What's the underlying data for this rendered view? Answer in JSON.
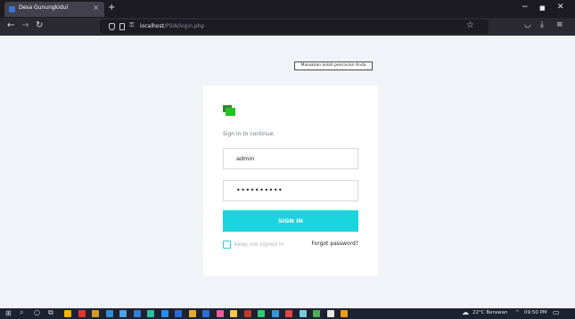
{
  "browser": {
    "tab_title": "Desa Gunungkidul",
    "tab_close": "×",
    "new_tab": "+",
    "window_controls": [
      "−",
      "■",
      "✕"
    ],
    "url_host": "localhost",
    "url_path": "/PSIA/login.php",
    "nav_icons": [
      "back-icon",
      "forward-icon",
      "reload-icon"
    ]
  },
  "tooltip": "Masukkan kolah pencarian Anda",
  "login": {
    "prompt": "Sign in to continue.",
    "username_value": "admin",
    "password_value": "••••••••••",
    "submit_label": "SIGN IN",
    "remember_label": "Keep me signed in",
    "forgot_label": "Forgot password?"
  },
  "taskbar": {
    "weather": "22°C  Berawan",
    "chevron": "^",
    "time": "09:50 PM",
    "app_colors": [
      "#d8d8de",
      "#d8d8de",
      "#d8d8de",
      "#f0b400",
      "#e2362b",
      "#d69a2b",
      "#2c8fd6",
      "#4ba3e3",
      "#3a7bd5",
      "#2ac3a2",
      "#1f8ff0",
      "#2a6ad9",
      "#e8a92b",
      "#2c6fd9",
      "#e85d9b",
      "#f2c94c",
      "#c0392b",
      "#2ecc71",
      "#3498db",
      "#e84343",
      "#7ec8e3",
      "#4caf50",
      "#e8e8e8",
      "#f39c12"
    ]
  },
  "colors": {
    "accent": "#1bd4dd",
    "logo_green": "#22c322",
    "page_bg": "#f2f3f8",
    "toolbar_bg": "#2b2a33"
  }
}
